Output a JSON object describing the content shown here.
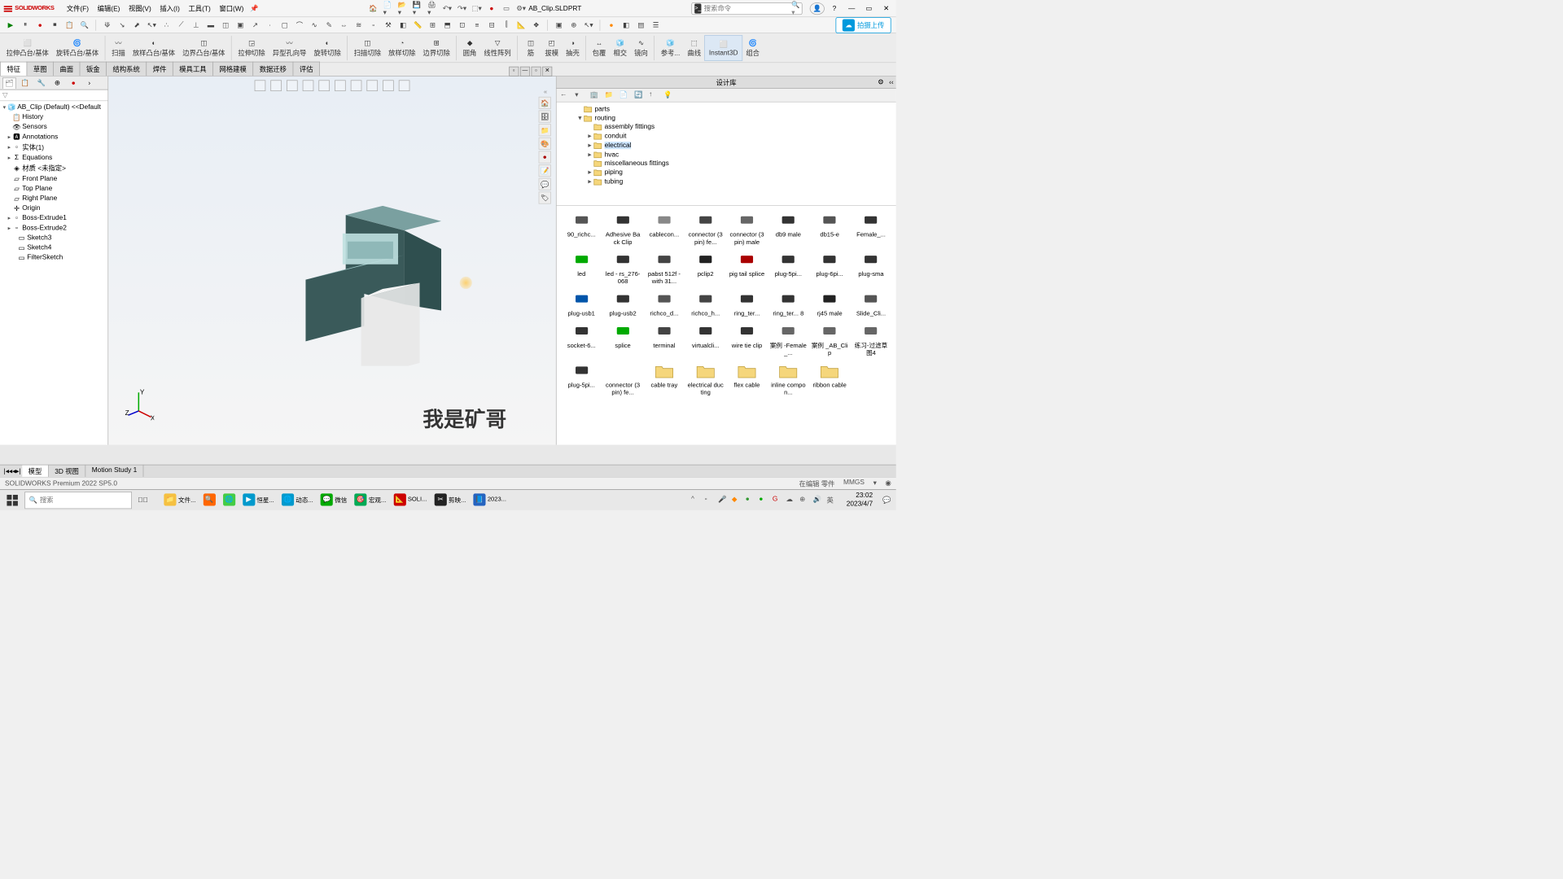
{
  "title_bar": {
    "logo_text": "SOLIDWORKS",
    "menus": [
      "文件(F)",
      "编辑(E)",
      "视图(V)",
      "插入(I)",
      "工具(T)",
      "窗口(W)"
    ],
    "doc_name": "AB_Clip.SLDPRT",
    "search_placeholder": "搜索命令"
  },
  "cloud_btn": "拍摄上传",
  "ribbon_groups": [
    [
      "拉伸凸台/基体",
      "旋转凸台/基体"
    ],
    [
      "扫描",
      "放样凸台/基体",
      "边界凸台/基体"
    ],
    [
      "拉伸切除",
      "异型孔向导",
      "旋转切除"
    ],
    [
      "扫描切除",
      "放样切除",
      "边界切除"
    ],
    [
      "圆角",
      "线性阵列"
    ],
    [
      "筋",
      "拔模",
      "抽壳"
    ],
    [
      "包覆",
      "相交",
      "镜向"
    ],
    [
      "参考...",
      "曲线",
      "Instant3D",
      "组合"
    ]
  ],
  "instant3d_selected": "Instant3D",
  "tabs": [
    "特征",
    "草图",
    "曲面",
    "钣金",
    "结构系统",
    "焊件",
    "模具工具",
    "网格建模",
    "数据迁移",
    "评估"
  ],
  "active_tab": "特征",
  "feature_tree": {
    "root": "AB_Clip (Default) <<Default",
    "items": [
      {
        "label": "History",
        "ind": 2,
        "ico": "📋"
      },
      {
        "label": "Sensors",
        "ind": 2,
        "ico": "👁"
      },
      {
        "label": "Annotations",
        "ind": 2,
        "ico": "🅰",
        "exp": "▸"
      },
      {
        "label": "实体(1)",
        "ind": 2,
        "ico": "▫",
        "exp": "▸"
      },
      {
        "label": "Equations",
        "ind": 2,
        "ico": "Σ",
        "exp": "▸"
      },
      {
        "label": "材质 <未指定>",
        "ind": 2,
        "ico": "◈"
      },
      {
        "label": "Front Plane",
        "ind": 2,
        "ico": "▱"
      },
      {
        "label": "Top Plane",
        "ind": 2,
        "ico": "▱"
      },
      {
        "label": "Right Plane",
        "ind": 2,
        "ico": "▱"
      },
      {
        "label": "Origin",
        "ind": 2,
        "ico": "✛"
      },
      {
        "label": "Boss-Extrude1",
        "ind": 2,
        "ico": "▫",
        "exp": "▸"
      },
      {
        "label": "Boss-Extrude2",
        "ind": 2,
        "ico": "▫",
        "exp": "▸"
      },
      {
        "label": "Sketch3",
        "ind": 3,
        "ico": "▭"
      },
      {
        "label": "Sketch4",
        "ind": 3,
        "ico": "▭"
      },
      {
        "label": "FilterSketch",
        "ind": 3,
        "ico": "▭"
      }
    ]
  },
  "watermark": "我是矿哥",
  "design_lib": {
    "title": "设计库",
    "tree": [
      {
        "label": "parts",
        "ind": 28,
        "exp": ""
      },
      {
        "label": "routing",
        "ind": 28,
        "exp": "▾"
      },
      {
        "label": "assembly fittings",
        "ind": 44,
        "exp": ""
      },
      {
        "label": "conduit",
        "ind": 44,
        "exp": "▸"
      },
      {
        "label": "electrical",
        "ind": 44,
        "exp": "▸",
        "sel": true
      },
      {
        "label": "hvac",
        "ind": 44,
        "exp": "▸"
      },
      {
        "label": "miscellaneous fittings",
        "ind": 44,
        "exp": ""
      },
      {
        "label": "piping",
        "ind": 44,
        "exp": "▸"
      },
      {
        "label": "tubing",
        "ind": 44,
        "exp": "▸"
      }
    ],
    "items": [
      "90_richc...",
      "Adhesive Back Clip",
      "cablecon...",
      "connector (3pin) fe...",
      "connector (3pin) male",
      "db9 male",
      "db15-e",
      "Female_...",
      "led",
      "led - rs_276-068",
      "pabst 512f - with 31...",
      "pclip2",
      "pig tail splice",
      "plug-5pi...",
      "plug-6pi...",
      "plug-sma",
      "plug-usb1",
      "plug-usb2",
      "richco_d...",
      "richco_h...",
      "ring_ter...",
      "ring_ter... 8",
      "rj45 male",
      "Slide_Cli...",
      "socket-6...",
      "splice",
      "terminal",
      "virtualcli...",
      "wire tie clip",
      "案例 -Female_...",
      "案例 _AB_Clip",
      "练习-过滤草图4",
      "plug-5pi...",
      "connector (3pin) fe...",
      "cable tray",
      "electrical ducting",
      "flex cable",
      "inline compon...",
      "ribbon cable"
    ]
  },
  "bottom_tabs": [
    "模型",
    "3D 视图",
    "Motion Study 1"
  ],
  "status": {
    "left": "SOLIDWORKS Premium 2022 SP5.0",
    "edit": "在编辑 零件",
    "units": "MMGS"
  },
  "taskbar": {
    "search_placeholder": "搜索",
    "apps": [
      "文件...",
      "",
      "",
      "恒星...",
      "动态...",
      "微信",
      "宏观...",
      "SOLI...",
      "剪映...",
      "2023..."
    ],
    "ime": "英",
    "time": "23:02",
    "date": "2023/4/7"
  }
}
